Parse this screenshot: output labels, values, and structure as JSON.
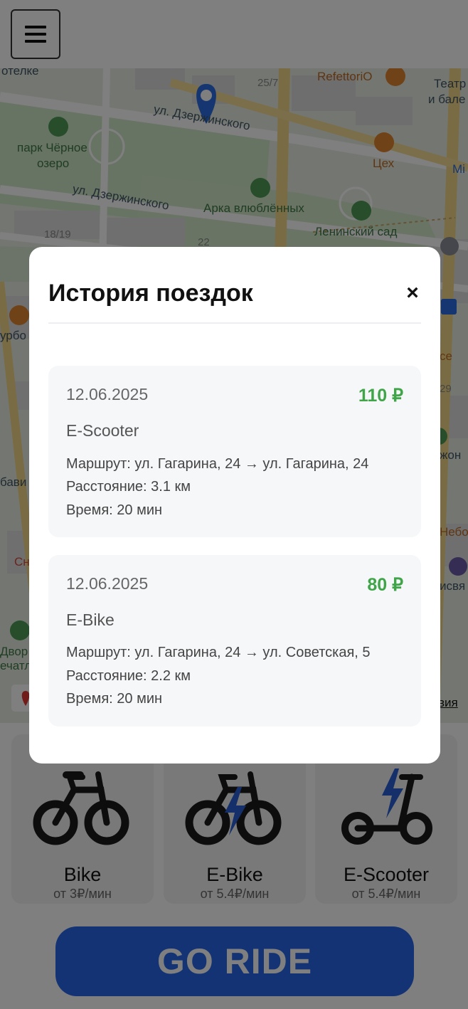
{
  "map": {
    "labels": {
      "hotel": "отелке",
      "restaurant": "RefettoriO",
      "theatre_line1": "Театр оп",
      "theatre_line2": "и бале",
      "house_25_7": "25/7",
      "street_top": "ул. Дзержинского",
      "park_line1": "парк Чёрное",
      "park_line2": "озеро",
      "tsekh": "Цех",
      "mi": "Mi",
      "street_mid": "ул. Дзержинского",
      "arch": "Арка влюблённых",
      "lenin_garden": "Ленинский сад",
      "house_18_19": "18/19",
      "house_22": "22",
      "left_1": "урбо",
      "right_se": "се",
      "right_29": "29",
      "right_zhon": "жон",
      "left_bav": "бави",
      "right_neb": "Небо",
      "left_sn": "Сн",
      "right_svya": "исвя",
      "left_dvor": "Двор",
      "left_chatl": "ечатл",
      "right_vija": "вия"
    }
  },
  "header": {
    "menu_icon": "hamburger-icon"
  },
  "modal": {
    "title": "История поездок",
    "close_label": "×",
    "trips": [
      {
        "date": "12.06.2025",
        "cost": "110 ₽",
        "type": "E-Scooter",
        "route": "Маршрут: ул. Гагарина, 24 → ул. Гагарина, 24",
        "distance": "Расстояние: 3.1 км",
        "time": "Время: 20 мин"
      },
      {
        "date": "12.06.2025",
        "cost": "80 ₽",
        "type": "E-Bike",
        "route": "Маршрут: ул. Гагарина, 24 → ул. Советская, 5",
        "distance": "Расстояние: 2.2 км",
        "time": "Время: 20 мин"
      }
    ]
  },
  "vehicles": [
    {
      "name": "Bike",
      "price": "от 3₽/мин",
      "icon": "bike-icon"
    },
    {
      "name": "E-Bike",
      "price": "от 5.4₽/мин",
      "icon": "ebike-icon"
    },
    {
      "name": "E-Scooter",
      "price": "от 5.4₽/мин",
      "icon": "escooter-icon"
    }
  ],
  "go_button": {
    "label": "GO RIDE"
  },
  "colors": {
    "accent": "#2866e8",
    "price_green": "#3fa548",
    "bolt_blue": "#2a5fd6"
  }
}
